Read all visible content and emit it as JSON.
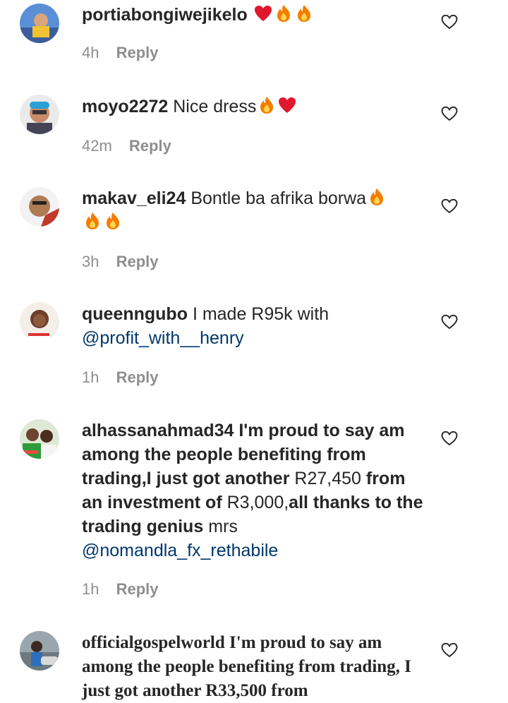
{
  "comments": [
    {
      "username": "portiabongiwejikelo",
      "time": "4h",
      "reply": "Reply"
    },
    {
      "username": "moyo2272",
      "text": "Nice dress",
      "time": "42m",
      "reply": "Reply"
    },
    {
      "username": "makav_eli24",
      "text": "Bontle ba afrika borwa",
      "time": "3h",
      "reply": "Reply"
    },
    {
      "username": "queenngubo",
      "text": "I made R95k with",
      "mention": "@profit_with__henry",
      "time": "1h",
      "reply": "Reply"
    },
    {
      "username": "alhassanahmad34",
      "parts": [
        "I'm proud to say am among the people benefiting from trading,I just got another",
        "R27,450",
        "from an investment of",
        "R3,000,",
        "all thanks to the trading genius",
        "mrs"
      ],
      "mention": "@nomandla_fx_rethabile",
      "time": "1h",
      "reply": "Reply"
    },
    {
      "username": "officialgospelworld",
      "text": "I'm proud to say am among the people benefiting from trading, I just got another R33,500 from"
    }
  ]
}
